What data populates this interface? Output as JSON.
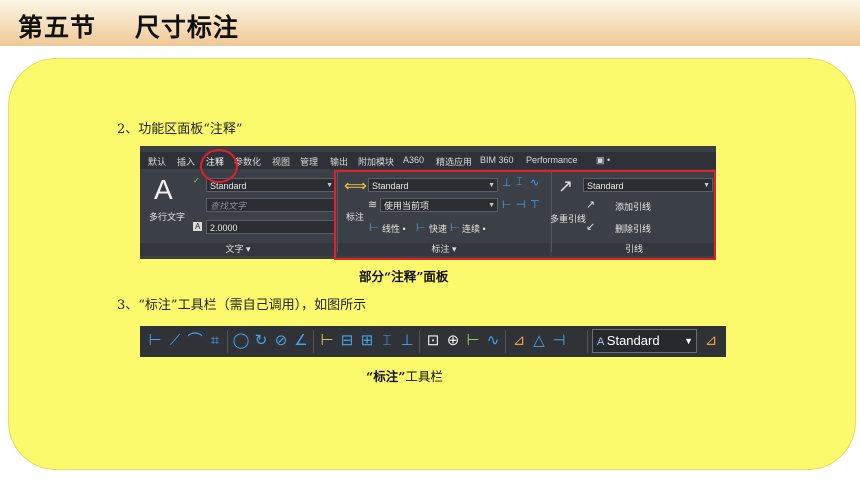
{
  "header": {
    "title": "第五节    尺寸标注"
  },
  "content": {
    "item2": "2、功能区面板“注释”",
    "caption1_bold": "部分“注释”面板",
    "item3": "3、“标注”工具栏（需自己调用），如图所示",
    "caption2_bold": "“标注”",
    "caption2_rest": "工具栏"
  },
  "ribbon": {
    "tabs": [
      "默认",
      "插入",
      "注释",
      "参数化",
      "视图",
      "管理",
      "输出",
      "附加模块",
      "A360",
      "精选应用",
      "BIM 360",
      "Performance",
      "▣ •"
    ],
    "active_tab": "注释",
    "text_panel": {
      "big_label": "多行文字",
      "style": "Standard",
      "find_placeholder": "查找文字",
      "height": "2.0000",
      "footer": "文字 ▾"
    },
    "dim_panel": {
      "big_label": "标注",
      "style": "Standard",
      "layer": "使用当前项",
      "row3": [
        "线性 •",
        "快速",
        "连续 •"
      ],
      "footer": "标注 ▾"
    },
    "leader_panel": {
      "big_label": "多重引线",
      "style": "Standard",
      "add": "添加引线",
      "remove": "删除引线",
      "footer": "引线"
    }
  },
  "toolbar": {
    "style": "Standard"
  },
  "colors": {
    "panel": "#fdf96c",
    "highlight": "#e0202a",
    "icon": "#4aa3e8"
  }
}
